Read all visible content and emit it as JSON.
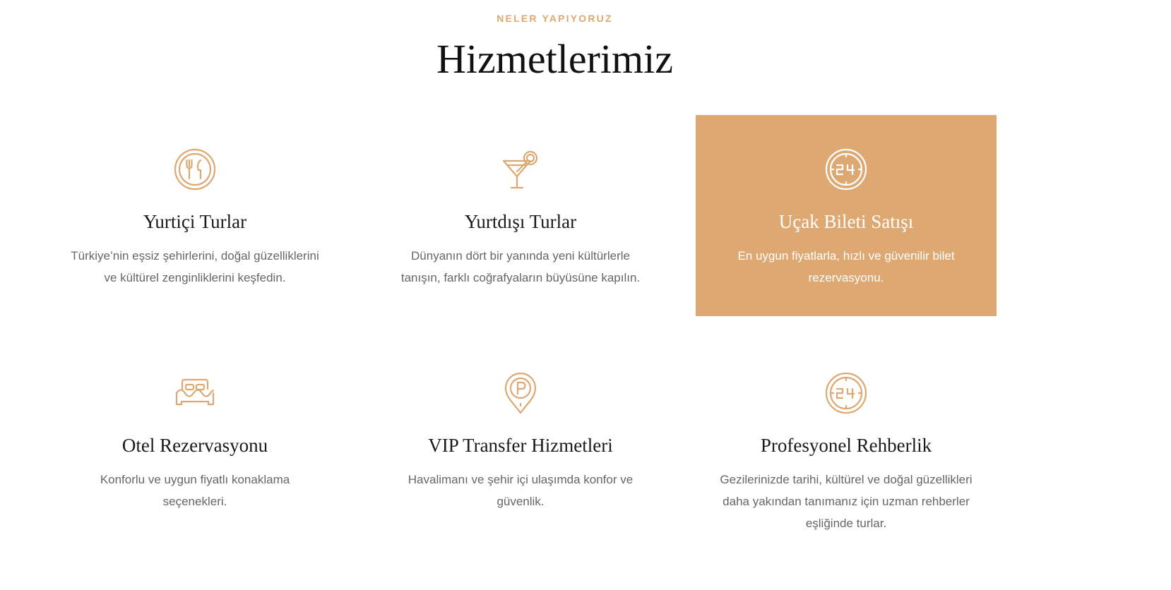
{
  "section": {
    "eyebrow": "NELER YAPIYORUZ",
    "title": "Hizmetlerimiz"
  },
  "colors": {
    "accent": "#dea872",
    "heading": "#1a1a1a",
    "body_text": "#666666",
    "highlight_text": "#ffffff"
  },
  "services": [
    {
      "icon": "dining-plate-icon",
      "title": "Yurtiçi Turlar",
      "description": "Türkiye’nin eşsiz şehirlerini, doğal güzelliklerini ve kültürel zenginliklerini keşfedin."
    },
    {
      "icon": "cocktail-glass-icon",
      "title": "Yurtdışı Turlar",
      "description": "Dünyanın dört bir yanında yeni kültürlerle tanışın, farklı coğrafyaların büyüsüne kapılın."
    },
    {
      "icon": "clock-24-icon",
      "title": "Uçak Bileti Satışı",
      "description": "En uygun fiyatlarla, hızlı ve güvenilir bilet rezervasyonu."
    },
    {
      "icon": "hotel-bed-icon",
      "title": "Otel Rezervasyonu",
      "description": "Konforlu ve uygun fiyatlı konaklama seçenekleri."
    },
    {
      "icon": "parking-pin-icon",
      "title": "VIP Transfer Hizmetleri",
      "description": "Havalimanı ve şehir içi ulaşımda konfor ve güvenlik."
    },
    {
      "icon": "clock-24-icon",
      "title": "Profesyonel Rehberlik",
      "description": "Gezilerinizde tarihi, kültürel ve doğal güzellikleri daha yakından tanımanız için uzman rehberler eşliğinde turlar."
    }
  ]
}
